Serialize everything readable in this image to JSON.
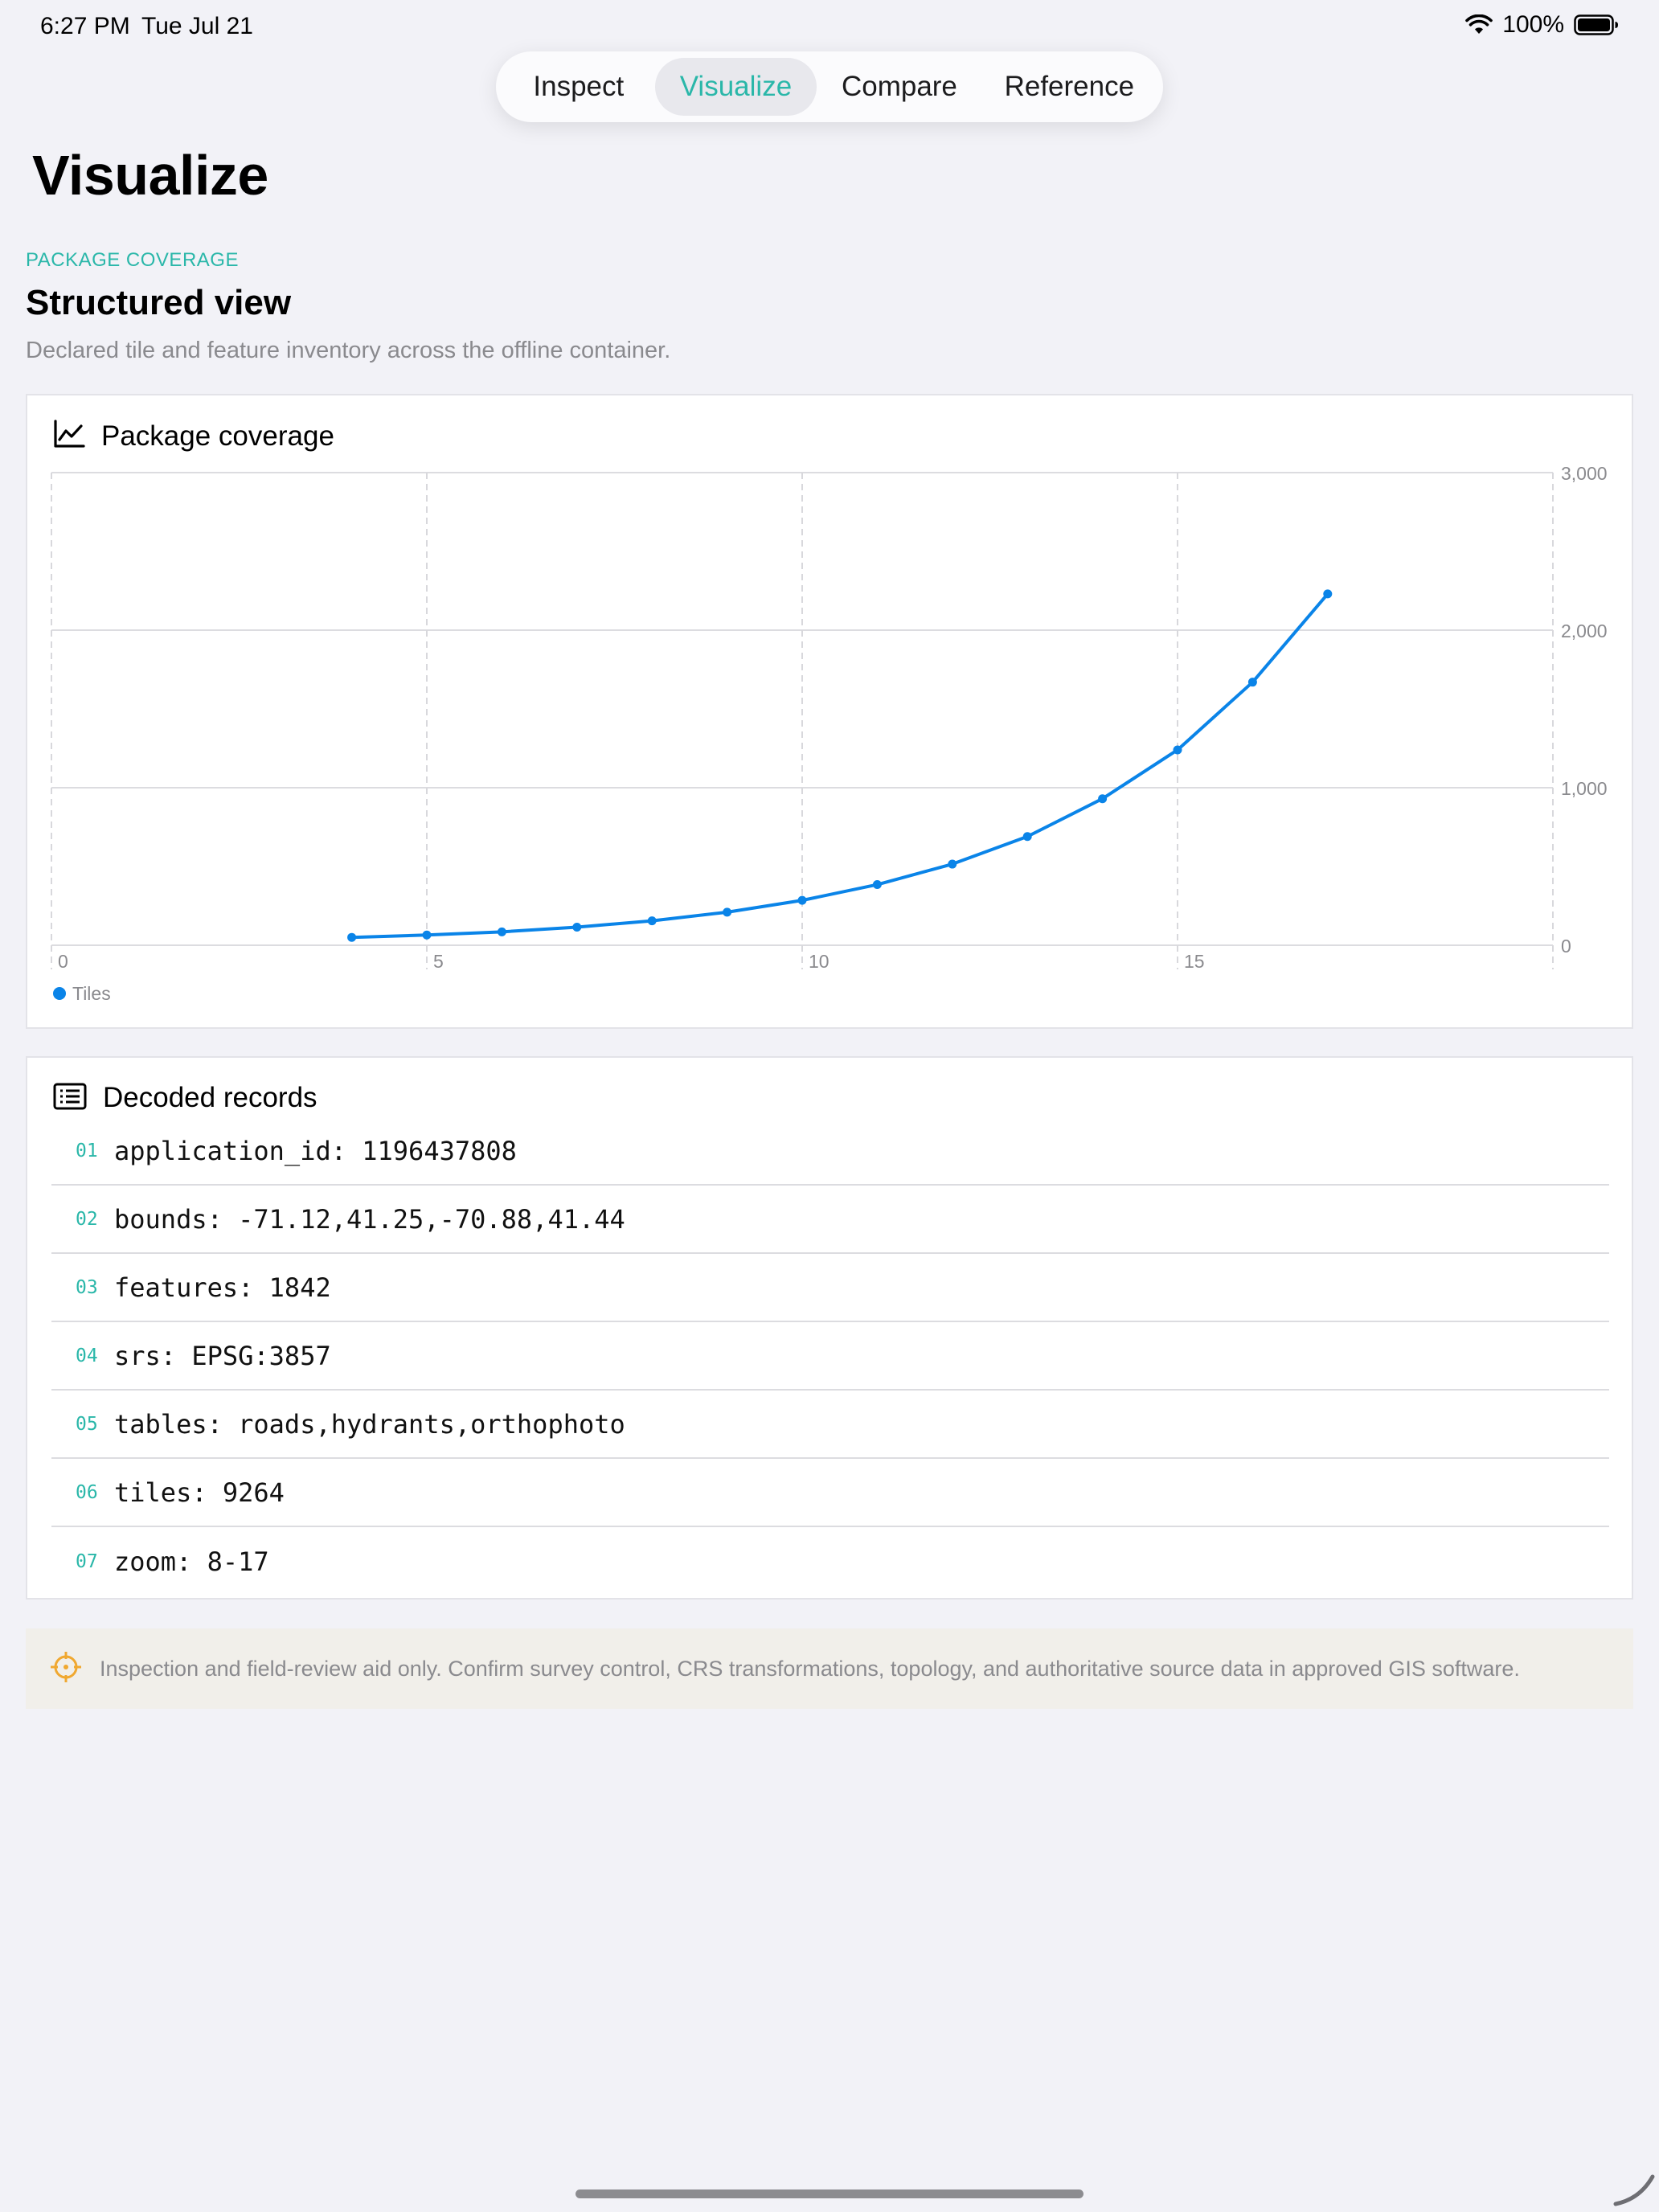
{
  "status_bar": {
    "time": "6:27 PM",
    "date": "Tue Jul 21",
    "battery_pct": "100%",
    "icons": [
      "wifi-icon",
      "battery-icon"
    ]
  },
  "tabs": [
    {
      "label": "Inspect",
      "selected": false
    },
    {
      "label": "Visualize",
      "selected": true
    },
    {
      "label": "Compare",
      "selected": false
    },
    {
      "label": "Reference",
      "selected": false
    }
  ],
  "page": {
    "title": "Visualize",
    "eyebrow": "PACKAGE COVERAGE",
    "section_title": "Structured view",
    "section_desc": "Declared tile and feature inventory across the offline container."
  },
  "chart_card": {
    "title": "Package coverage",
    "icon": "line-chart-icon"
  },
  "chart_data": {
    "type": "line",
    "title": "Package coverage",
    "xlim": [
      0,
      20
    ],
    "ylim": [
      0,
      3000
    ],
    "x_ticks": [
      0,
      5,
      10,
      15
    ],
    "x_tick_labels": [
      "0",
      "5",
      "10",
      "15"
    ],
    "y_ticks": [
      0,
      1000,
      2000,
      3000
    ],
    "y_tick_labels": [
      "0",
      "1,000",
      "2,000",
      "3,000"
    ],
    "y_axis_side": "right",
    "grid": true,
    "legend_position": "bottom-left",
    "series": [
      {
        "name": "Tiles",
        "color": "#0a84e8",
        "x": [
          4,
          5,
          6,
          7,
          8,
          9,
          10,
          11,
          12,
          13,
          14,
          15,
          16,
          17
        ],
        "y": [
          50,
          65,
          85,
          115,
          155,
          210,
          285,
          385,
          515,
          690,
          930,
          1240,
          1670,
          2230
        ]
      }
    ]
  },
  "records_card": {
    "title": "Decoded records",
    "icon": "list-icon",
    "rows": [
      {
        "num": "01",
        "text": "application_id: 1196437808"
      },
      {
        "num": "02",
        "text": "bounds: -71.12,41.25,-70.88,41.44"
      },
      {
        "num": "03",
        "text": "features: 1842"
      },
      {
        "num": "04",
        "text": "srs: EPSG:3857"
      },
      {
        "num": "05",
        "text": "tables: roads,hydrants,orthophoto"
      },
      {
        "num": "06",
        "text": "tiles: 9264"
      },
      {
        "num": "07",
        "text": "zoom: 8-17"
      }
    ]
  },
  "disclaimer": {
    "icon": "crosshair-icon",
    "icon_color": "#f0a830",
    "text": "Inspection and field-review aid only. Confirm survey control, CRS transformations, topology, and authoritative source data in approved GIS software."
  },
  "colors": {
    "accent": "#2ab7a9",
    "series": "#0a84e8",
    "background": "#f2f2f7"
  }
}
